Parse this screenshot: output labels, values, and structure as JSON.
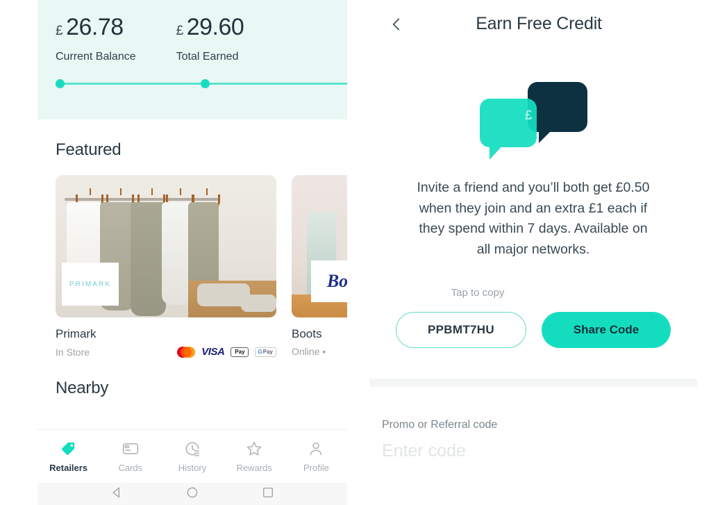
{
  "left_screen": {
    "balance": {
      "current": {
        "currency": "£",
        "amount": "26.78",
        "label": "Current Balance"
      },
      "total": {
        "currency": "£",
        "amount": "29.60",
        "label": "Total Earned"
      }
    },
    "sections": {
      "featured": "Featured",
      "nearby": "Nearby"
    },
    "retailers": [
      {
        "name": "Primark",
        "sub": "In Store",
        "logo_text": "PRIMARK",
        "pay_methods": [
          "mastercard",
          "visa",
          "apple-pay",
          "google-pay"
        ]
      },
      {
        "name": "Boots",
        "sub": "Online •",
        "logo_text": "Bo",
        "pay_methods": []
      }
    ],
    "tabs": [
      {
        "label": "Retailers",
        "icon": "tag-icon",
        "active": true
      },
      {
        "label": "Cards",
        "icon": "card-icon",
        "active": false
      },
      {
        "label": "History",
        "icon": "history-clock-icon",
        "active": false
      },
      {
        "label": "Rewards",
        "icon": "star-icon",
        "active": false
      },
      {
        "label": "Profile",
        "icon": "person-icon",
        "active": false
      }
    ],
    "system_nav": [
      "back-triangle-icon",
      "home-circle-icon",
      "recents-square-icon"
    ]
  },
  "right_screen": {
    "header": {
      "back_icon": "chevron-left-icon",
      "title": "Earn Free Credit"
    },
    "illustration": {
      "icon": "speech-bubbles-pound-icon",
      "pound_symbol": "£"
    },
    "body_text": "Invite a friend and you’ll both get £0.50 when they join and an extra £1 each if they spend within 7 days. Available on all major networks.",
    "tap_to_copy": "Tap to copy",
    "referral_code": "PPBMT7HU",
    "share_button": "Share Code",
    "promo": {
      "label": "Promo or Referral code",
      "placeholder": "Enter code",
      "value": ""
    }
  },
  "colors": {
    "teal": "#14ddbf",
    "teal_light": "#58e3d0",
    "mint_bg": "#e9f8f5",
    "navy": "#0d3140",
    "text_dark": "#2b3a42",
    "text_muted": "#9aa2a6"
  }
}
